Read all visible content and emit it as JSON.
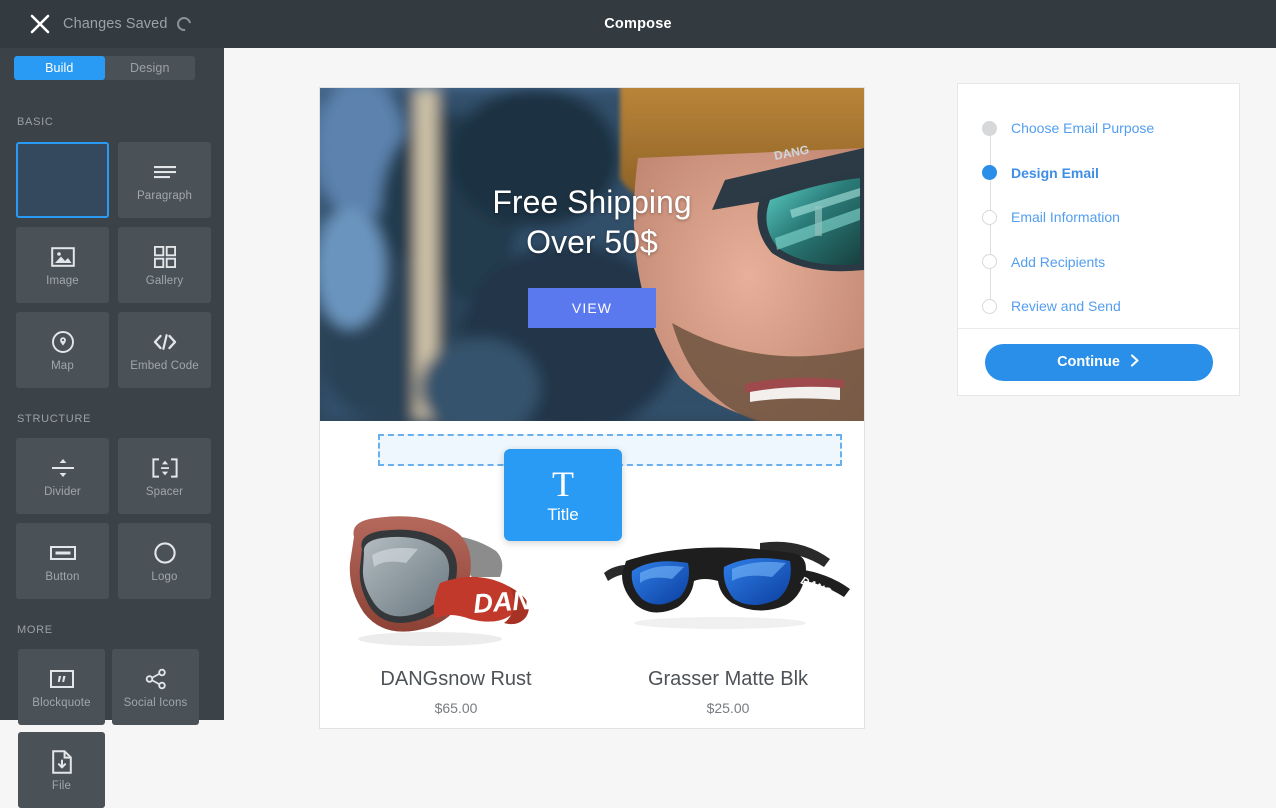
{
  "topbar": {
    "close_icon": "close-icon",
    "status_text": "Changes Saved",
    "spinner_icon": "loading-spinner-icon",
    "title": "Compose"
  },
  "sidebar": {
    "segments": [
      {
        "label": "Build",
        "active": true
      },
      {
        "label": "Design",
        "active": false
      }
    ],
    "sections": [
      {
        "label": "BASIC",
        "tiles": [
          {
            "label": "",
            "icon": "empty-placeholder",
            "placeholder": true
          },
          {
            "label": "Paragraph",
            "icon": "paragraph-icon"
          },
          {
            "label": "Image",
            "icon": "image-icon"
          },
          {
            "label": "Gallery",
            "icon": "gallery-icon"
          },
          {
            "label": "Map",
            "icon": "map-pin-icon"
          },
          {
            "label": "Embed Code",
            "icon": "code-icon"
          }
        ]
      },
      {
        "label": "STRUCTURE",
        "tiles": [
          {
            "label": "Divider",
            "icon": "divider-icon"
          },
          {
            "label": "Spacer",
            "icon": "spacer-icon"
          },
          {
            "label": "Button",
            "icon": "button-icon"
          },
          {
            "label": "Logo",
            "icon": "logo-circle-icon"
          }
        ]
      },
      {
        "label": "MORE",
        "tiles": [
          {
            "label": "Blockquote",
            "icon": "blockquote-icon"
          },
          {
            "label": "Social Icons",
            "icon": "share-icon"
          },
          {
            "label": "File",
            "icon": "file-download-icon"
          }
        ]
      }
    ]
  },
  "drag_ghost": {
    "glyph": "T",
    "label": "Title",
    "icon": "title-icon",
    "color": "#2a9bf4"
  },
  "email": {
    "hero": {
      "headline_line1": "Free Shipping",
      "headline_line2": "Over 50$",
      "button_label": "VIEW",
      "button_color": "#5b79ef"
    },
    "dropzone": {
      "label": "",
      "border_color": "#6ab0ee",
      "fill_color": "#eff7fe"
    },
    "products": [
      {
        "name": "DANGsnow Rust",
        "price": "$65.00",
        "image": "ski-goggles-rust"
      },
      {
        "name": "Grasser Matte Blk",
        "price": "$25.00",
        "image": "sunglasses-matte-black"
      }
    ]
  },
  "right_panel": {
    "steps": [
      {
        "label": "Choose Email Purpose",
        "state": "done"
      },
      {
        "label": "Design Email",
        "state": "current"
      },
      {
        "label": "Email Information",
        "state": "todo"
      },
      {
        "label": "Add Recipients",
        "state": "todo"
      },
      {
        "label": "Review and Send",
        "state": "todo"
      }
    ],
    "continue_label": "Continue",
    "continue_icon": "chevron-right-icon",
    "accent_color": "#2a8fe8"
  }
}
